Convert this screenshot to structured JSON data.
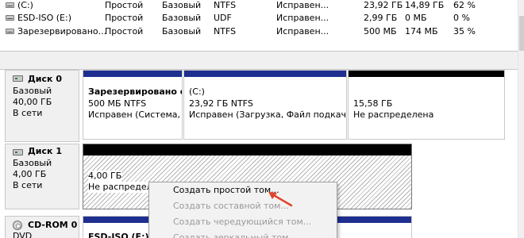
{
  "volumes": [
    {
      "name": "(C:)",
      "layout": "Простой",
      "type": "Базовый",
      "fs": "NTFS",
      "status": "Исправен...",
      "capacity": "23,92 ГБ",
      "free": "14,89 ГБ",
      "pct": "62 %"
    },
    {
      "name": "ESD-ISO (E:)",
      "layout": "Простой",
      "type": "Базовый",
      "fs": "UDF",
      "status": "Исправен...",
      "capacity": "2,99 ГБ",
      "free": "0 МБ",
      "pct": "0 %"
    },
    {
      "name": "Зарезервировано...",
      "layout": "Простой",
      "type": "Базовый",
      "fs": "NTFS",
      "status": "Исправен...",
      "capacity": "500 МБ",
      "free": "174 МБ",
      "pct": "35 %"
    }
  ],
  "disks": [
    {
      "title": "Диск 0",
      "kind": "Базовый",
      "size": "40,00 ГБ",
      "state": "В сети",
      "partitions": [
        {
          "name": "Зарезервировано си",
          "size": "500 МБ NTFS",
          "status": "Исправен (Система, А"
        },
        {
          "name": "(C:)",
          "size": "23,92 ГБ NTFS",
          "status": "Исправен (Загрузка, Файл подкачки,"
        },
        {
          "name": "",
          "size": "15,58 ГБ",
          "status": "Не распределена"
        }
      ]
    },
    {
      "title": "Диск 1",
      "kind": "Базовый",
      "size": "4,00 ГБ",
      "state": "В сети",
      "partitions": [
        {
          "size": "4,00 ГБ",
          "status": "Не распределе"
        }
      ]
    },
    {
      "title": "CD-ROM 0",
      "kind": "DVD",
      "partitions": [
        {
          "name": "ESD-ISO (E:)"
        }
      ]
    }
  ],
  "context_menu": [
    {
      "label": "Создать простой том...",
      "enabled": true
    },
    {
      "label": "Создать составной том...",
      "enabled": false
    },
    {
      "label": "Создать чередующийся том...",
      "enabled": false
    },
    {
      "label": "Создать зеркальный том...",
      "enabled": false
    }
  ],
  "colors": {
    "primary_partition_bar": "#1f2f8f",
    "unallocated_bar": "#000000",
    "pointer_arrow": "#e0452b"
  }
}
